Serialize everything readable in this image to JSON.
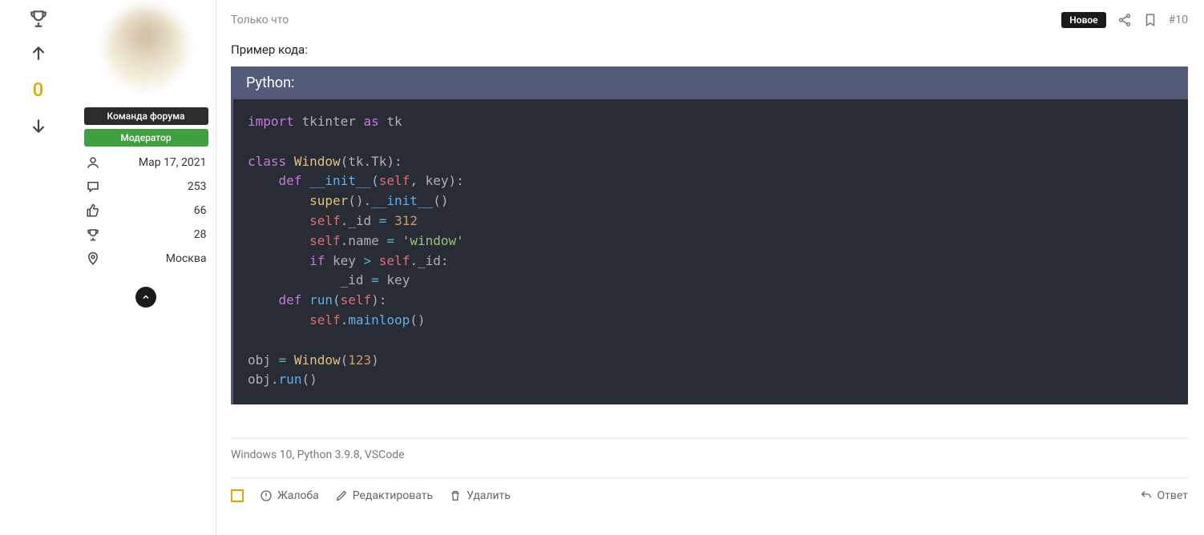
{
  "vote": {
    "count": "0"
  },
  "user": {
    "badge_team": "Команда форума",
    "badge_mod": "Модератор",
    "join_date": "Мар 17, 2021",
    "posts": "253",
    "likes": "66",
    "trophies": "28",
    "location": "Москва"
  },
  "post": {
    "timestamp": "Только что",
    "new_label": "Новое",
    "post_number": "#10",
    "intro": "Пример кода:",
    "code_lang": "Python:",
    "signature": "Windows 10, Python 3.9.8, VSCode"
  },
  "code": {
    "l1_import": "import",
    "l1_mod": "tkinter",
    "l1_as": "as",
    "l1_alias": "tk",
    "l3_class": "class",
    "l3_name": "Window",
    "l3_base": "tk.Tk",
    "l4_def": "def",
    "l4_init": "__init__",
    "l4_self": "self",
    "l4_arg": "key",
    "l5_super": "super",
    "l5_init": "__init__",
    "l6_self": "self",
    "l6_attr": "_id",
    "l6_val": "312",
    "l7_self": "self",
    "l7_attr": "name",
    "l7_val": "'window'",
    "l8_if": "if",
    "l8_key": "key",
    "l8_self": "self",
    "l8_attr": "_id",
    "l9_id": "_id",
    "l9_key": "key",
    "l10_def": "def",
    "l10_run": "run",
    "l10_self": "self",
    "l11_self": "self",
    "l11_ml": "mainloop",
    "l13_obj": "obj",
    "l13_win": "Window",
    "l13_arg": "123",
    "l14_obj": "obj",
    "l14_run": "run"
  },
  "actions": {
    "report": "Жалоба",
    "edit": "Редактировать",
    "delete": "Удалить",
    "reply": "Ответ"
  }
}
